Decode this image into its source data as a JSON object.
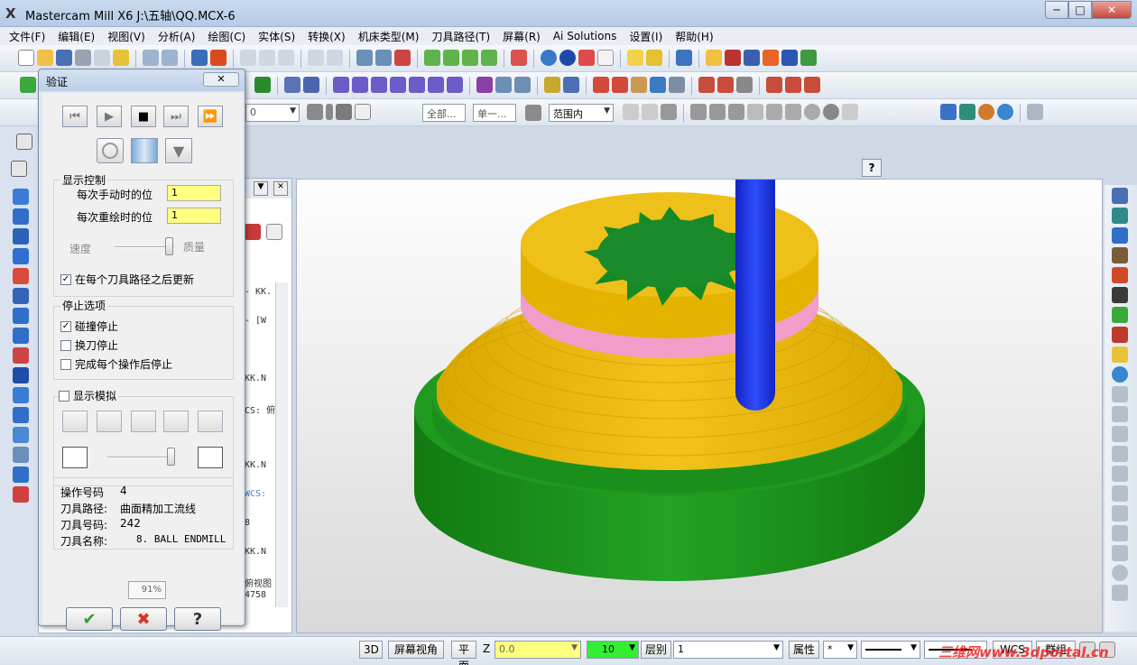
{
  "window": {
    "title": "Mastercam Mill X6  J:\\五轴\\QQ.MCX-6",
    "min_glyph": "─",
    "max_glyph": "□",
    "close_glyph": "✕"
  },
  "menu": [
    "文件(F)",
    "编辑(E)",
    "视图(V)",
    "分析(A)",
    "绘图(C)",
    "实体(S)",
    "转换(X)",
    "机床类型(M)",
    "刀具路径(T)",
    "屏幕(R)",
    "Ai Solutions",
    "设置(I)",
    "帮助(H)"
  ],
  "toolbar3": {
    "combo_value": "0",
    "all_label": "全部...",
    "single_label": "单一...",
    "range_value": "范围内"
  },
  "ops_panel": {
    "lines": [
      "- KK.",
      "- [W",
      "",
      "KK.N",
      "CS: 俯",
      "",
      "KK.N",
      "WCS:",
      "8",
      "KK.N",
      "俯视图",
      "4758"
    ]
  },
  "dialog": {
    "title": "验证",
    "close_glyph": "✕",
    "display_control_label": "显示控制",
    "manual_step_label": "每次手动时的位",
    "manual_step_value": "1",
    "redraw_step_label": "每次重绘时的位",
    "redraw_step_value": "1",
    "speed_label": "速度",
    "quality_label": "质量",
    "update_after_each": "在每个刀具路径之后更新",
    "stop_options_label": "停止选项",
    "stop_on_collision": "碰撞停止",
    "stop_on_tool_change": "换刀停止",
    "stop_after_each_op": "完成每个操作后停止",
    "show_simulation": "显示模拟",
    "info": {
      "op_number_label": "操作号码",
      "op_number_value": "4",
      "toolpath_label": "刀具路径:",
      "toolpath_value": "曲面精加工流线",
      "tool_number_label": "刀具号码:",
      "tool_number_value": "242",
      "tool_name_label": "刀具名称:",
      "tool_name_value": "8. BALL ENDMILL"
    },
    "progress_text": "91%",
    "progress_percent": 91,
    "ok_glyph": "✔",
    "cancel_glyph": "✖",
    "help_glyph": "?"
  },
  "statusbar": {
    "btn_3d": "3D",
    "btn_screen_view": "屏幕视角",
    "btn_plane": "平面",
    "z_label": "Z",
    "z_value": "0.0",
    "color_value": "10",
    "level_label": "层别",
    "level_value": "1",
    "attr_label": "属性",
    "wcs_label": "WCS",
    "group_label": "群组"
  },
  "watermark": "三维网www.3dportal.cn",
  "colors": {
    "part_yellow": "#e8b800",
    "part_green": "#1e8b1e",
    "band_pink": "#ee9ec8",
    "tool_blue": "#1a2fe0",
    "field_yellow": "#ffff80"
  }
}
